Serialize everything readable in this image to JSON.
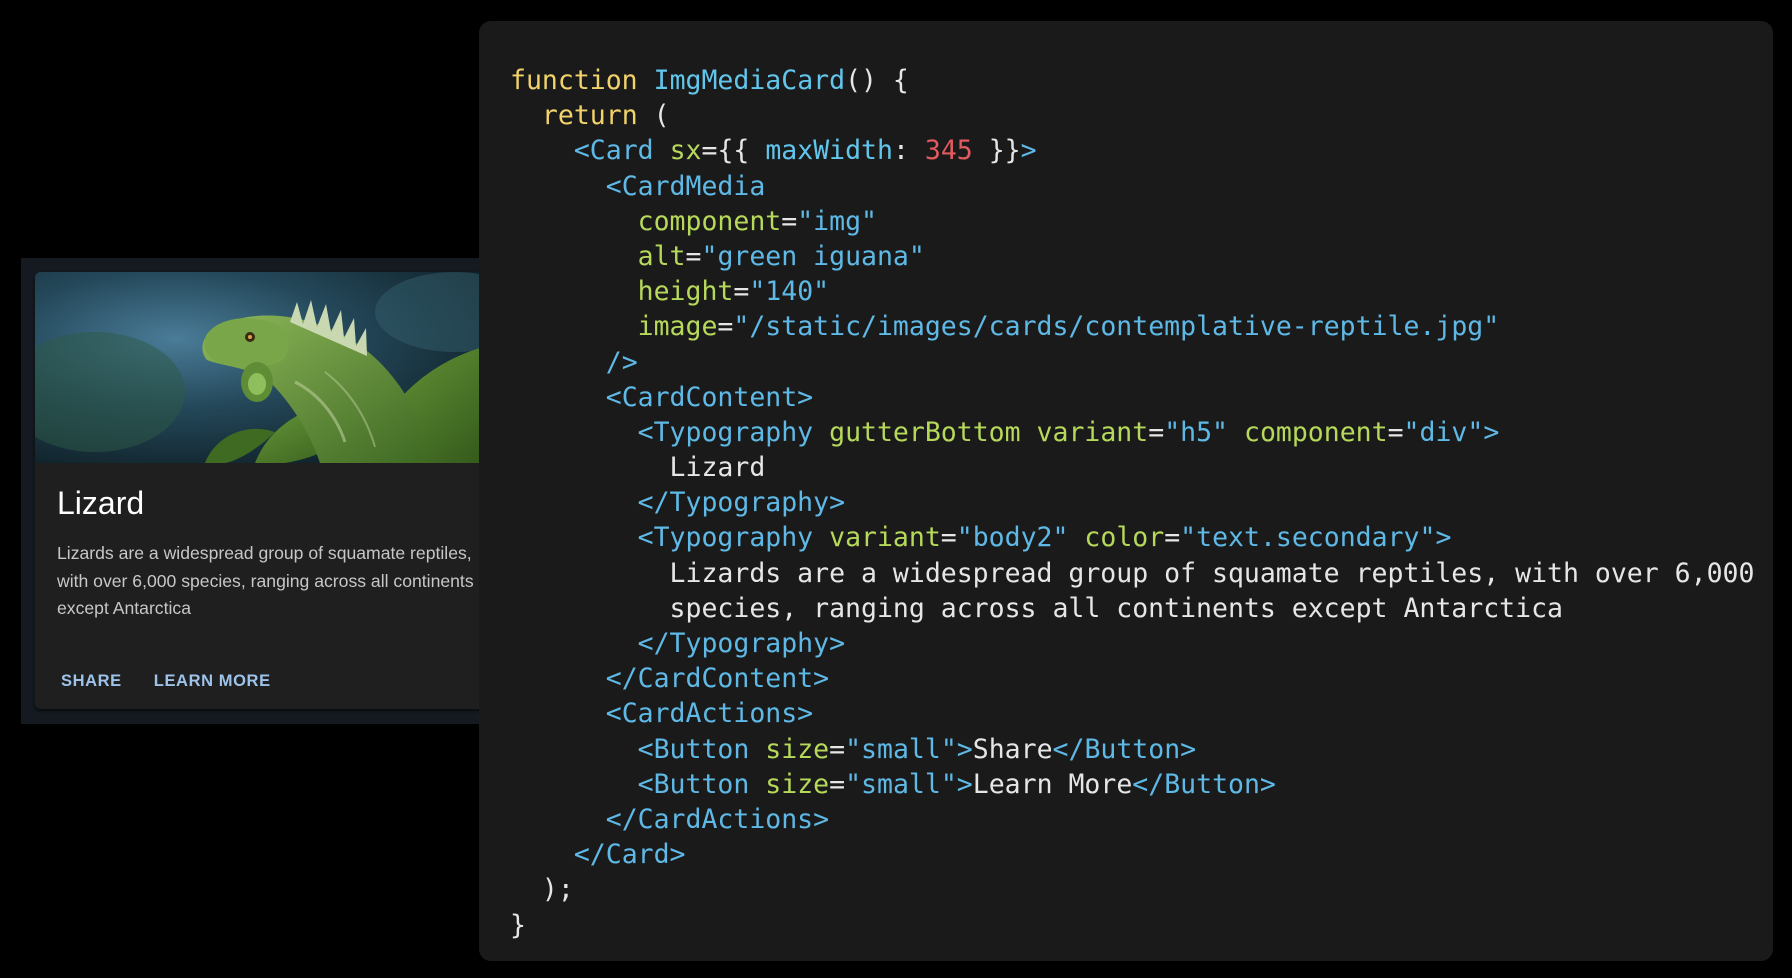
{
  "card": {
    "media_alt": "green iguana",
    "title": "Lizard",
    "body": "Lizards are a widespread group of squamate reptiles, with over 6,000 species, ranging across all continents except Antarctica",
    "actions": [
      "Share",
      "Learn More"
    ],
    "action_color": "#9ec3ea"
  },
  "colors": {
    "keyword": "#f2d36b",
    "function": "#62c6ec",
    "tag": "#5fb9e6",
    "attribute": "#b6d85b",
    "number": "#e05a5f",
    "text": "#e6e6e6",
    "panel_bg": "#1a1a1a"
  },
  "code": {
    "lines": [
      [
        [
          "kw",
          "function"
        ],
        [
          "txt",
          " "
        ],
        [
          "fn",
          "ImgMediaCard"
        ],
        [
          "pun",
          "() {"
        ]
      ],
      [
        [
          "txt",
          "  "
        ],
        [
          "kw",
          "return"
        ],
        [
          "pun",
          " ("
        ]
      ],
      [
        [
          "txt",
          "    "
        ],
        [
          "tag",
          "<Card"
        ],
        [
          "txt",
          " "
        ],
        [
          "attr",
          "sx"
        ],
        [
          "pun",
          "={{ "
        ],
        [
          "fn",
          "maxWidth"
        ],
        [
          "pun",
          ": "
        ],
        [
          "num",
          "345"
        ],
        [
          "pun",
          " }}"
        ],
        [
          "tag",
          ">"
        ]
      ],
      [
        [
          "txt",
          "      "
        ],
        [
          "tag",
          "<CardMedia"
        ]
      ],
      [
        [
          "txt",
          "        "
        ],
        [
          "attr",
          "component"
        ],
        [
          "pun",
          "="
        ],
        [
          "str",
          "\"img\""
        ]
      ],
      [
        [
          "txt",
          "        "
        ],
        [
          "attr",
          "alt"
        ],
        [
          "pun",
          "="
        ],
        [
          "str",
          "\"green iguana\""
        ]
      ],
      [
        [
          "txt",
          "        "
        ],
        [
          "attr",
          "height"
        ],
        [
          "pun",
          "="
        ],
        [
          "str",
          "\"140\""
        ]
      ],
      [
        [
          "txt",
          "        "
        ],
        [
          "attr",
          "image"
        ],
        [
          "pun",
          "="
        ],
        [
          "str",
          "\"/static/images/cards/contemplative-reptile.jpg\""
        ]
      ],
      [
        [
          "txt",
          "      "
        ],
        [
          "tag",
          "/>"
        ]
      ],
      [
        [
          "txt",
          "      "
        ],
        [
          "tag",
          "<CardContent>"
        ]
      ],
      [
        [
          "txt",
          "        "
        ],
        [
          "tag",
          "<Typography"
        ],
        [
          "txt",
          " "
        ],
        [
          "attr",
          "gutterBottom"
        ],
        [
          "txt",
          " "
        ],
        [
          "attr",
          "variant"
        ],
        [
          "pun",
          "="
        ],
        [
          "str",
          "\"h5\""
        ],
        [
          "txt",
          " "
        ],
        [
          "attr",
          "component"
        ],
        [
          "pun",
          "="
        ],
        [
          "str",
          "\"div\""
        ],
        [
          "tag",
          ">"
        ]
      ],
      [
        [
          "txt",
          "          Lizard"
        ]
      ],
      [
        [
          "txt",
          "        "
        ],
        [
          "tag",
          "</Typography>"
        ]
      ],
      [
        [
          "txt",
          "        "
        ],
        [
          "tag",
          "<Typography"
        ],
        [
          "txt",
          " "
        ],
        [
          "attr",
          "variant"
        ],
        [
          "pun",
          "="
        ],
        [
          "str",
          "\"body2\""
        ],
        [
          "txt",
          " "
        ],
        [
          "attr",
          "color"
        ],
        [
          "pun",
          "="
        ],
        [
          "str",
          "\"text.secondary\""
        ],
        [
          "tag",
          ">"
        ]
      ],
      [
        [
          "txt",
          "          Lizards are a widespread group of squamate reptiles, with over 6,000"
        ]
      ],
      [
        [
          "txt",
          "          species, ranging across all continents except Antarctica"
        ]
      ],
      [
        [
          "txt",
          "        "
        ],
        [
          "tag",
          "</Typography>"
        ]
      ],
      [
        [
          "txt",
          "      "
        ],
        [
          "tag",
          "</CardContent>"
        ]
      ],
      [
        [
          "txt",
          "      "
        ],
        [
          "tag",
          "<CardActions>"
        ]
      ],
      [
        [
          "txt",
          "        "
        ],
        [
          "tag",
          "<Button"
        ],
        [
          "txt",
          " "
        ],
        [
          "attr",
          "size"
        ],
        [
          "pun",
          "="
        ],
        [
          "str",
          "\"small\""
        ],
        [
          "tag",
          ">"
        ],
        [
          "txt",
          "Share"
        ],
        [
          "tag",
          "</Button>"
        ]
      ],
      [
        [
          "txt",
          "        "
        ],
        [
          "tag",
          "<Button"
        ],
        [
          "txt",
          " "
        ],
        [
          "attr",
          "size"
        ],
        [
          "pun",
          "="
        ],
        [
          "str",
          "\"small\""
        ],
        [
          "tag",
          ">"
        ],
        [
          "txt",
          "Learn More"
        ],
        [
          "tag",
          "</Button>"
        ]
      ],
      [
        [
          "txt",
          "      "
        ],
        [
          "tag",
          "</CardActions>"
        ]
      ],
      [
        [
          "txt",
          "    "
        ],
        [
          "tag",
          "</Card>"
        ]
      ],
      [
        [
          "pun",
          "  );"
        ]
      ],
      [
        [
          "pun",
          "}"
        ]
      ]
    ]
  }
}
